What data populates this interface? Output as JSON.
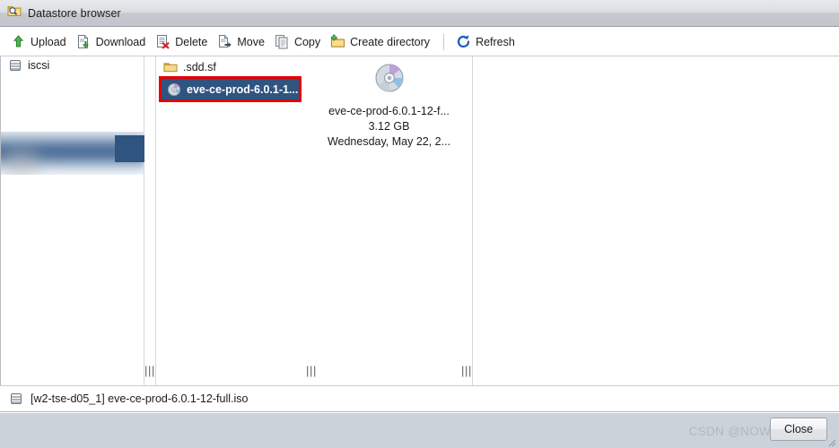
{
  "window": {
    "title": "Datastore browser",
    "title_icon": "folder-search-icon"
  },
  "toolbar": {
    "buttons": [
      {
        "label": "Upload",
        "icon": "upload-arrow-icon"
      },
      {
        "label": "Download",
        "icon": "download-page-icon"
      },
      {
        "label": "Delete",
        "icon": "delete-page-icon"
      },
      {
        "label": "Move",
        "icon": "move-page-icon"
      },
      {
        "label": "Copy",
        "icon": "copy-pages-icon"
      },
      {
        "label": "Create directory",
        "icon": "new-folder-icon"
      },
      {
        "label": "Refresh",
        "icon": "refresh-icon"
      }
    ],
    "separator_after_index": 5
  },
  "columns": {
    "datastores": {
      "items": [
        {
          "label": "iscsi",
          "icon": "datastore-icon",
          "selected": false,
          "redacted": false
        },
        {
          "label": "",
          "icon": "datastore-icon",
          "selected": true,
          "redacted": true
        }
      ]
    },
    "folders": {
      "items": [
        {
          "label": ".sdd.sf",
          "icon": "folder-icon",
          "selected": false
        },
        {
          "label": "eve-ce-prod-6.0.1-1...",
          "icon": "iso-disc-icon",
          "selected": true,
          "annotated": true
        }
      ]
    },
    "details": {
      "icon": "iso-disc-icon",
      "name": "eve-ce-prod-6.0.1-12-f...",
      "size": "3.12 GB",
      "modified": "Wednesday, May 22, 2..."
    },
    "empty": {
      "items": []
    },
    "grips": [
      "|||",
      "|||",
      "|||"
    ]
  },
  "status": {
    "icon": "datastore-icon",
    "text": "[w2-tse-d05_1] eve-ce-prod-6.0.1-12-full.iso"
  },
  "footer": {
    "close_label": "Close",
    "watermark": "CSDN @NOWSHUT"
  },
  "colors": {
    "selection_blue": "#2f5480",
    "annotation_red": "#e60000",
    "titlebar_grey": "#dcdee2",
    "footer_grey": "#ccd2da"
  }
}
